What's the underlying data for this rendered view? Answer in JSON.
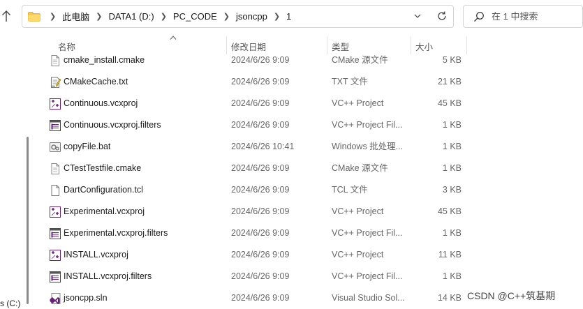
{
  "address": {
    "crumbs": [
      "此电脑",
      "DATA1 (D:)",
      "PC_CODE",
      "jsoncpp",
      "1"
    ]
  },
  "search": {
    "placeholder": "在 1 中搜索"
  },
  "left_pane": {
    "drive_label": "s (C:)"
  },
  "columns": {
    "name": "名称",
    "date": "修改日期",
    "type": "类型",
    "size": "大小"
  },
  "files": [
    {
      "name": "cmake_install.cmake",
      "date": "2024/6/26 9:09",
      "type": "CMake 源文件",
      "size": "5 KB",
      "icon": "cmake-file-icon"
    },
    {
      "name": "CMakeCache.txt",
      "date": "2024/6/26 9:09",
      "type": "TXT 文件",
      "size": "21 KB",
      "icon": "text-file-icon"
    },
    {
      "name": "Continuous.vcxproj",
      "date": "2024/6/26 9:09",
      "type": "VC++ Project",
      "size": "45 KB",
      "icon": "vcxproj-icon"
    },
    {
      "name": "Continuous.vcxproj.filters",
      "date": "2024/6/26 9:09",
      "type": "VC++ Project Fil...",
      "size": "1 KB",
      "icon": "filters-icon"
    },
    {
      "name": "copyFile.bat",
      "date": "2024/6/26 10:41",
      "type": "Windows 批处理...",
      "size": "1 KB",
      "icon": "bat-file-icon"
    },
    {
      "name": "CTestTestfile.cmake",
      "date": "2024/6/26 9:09",
      "type": "CMake 源文件",
      "size": "1 KB",
      "icon": "cmake-file-icon"
    },
    {
      "name": "DartConfiguration.tcl",
      "date": "2024/6/26 9:09",
      "type": "TCL 文件",
      "size": "3 KB",
      "icon": "blank-file-icon"
    },
    {
      "name": "Experimental.vcxproj",
      "date": "2024/6/26 9:09",
      "type": "VC++ Project",
      "size": "45 KB",
      "icon": "vcxproj-icon"
    },
    {
      "name": "Experimental.vcxproj.filters",
      "date": "2024/6/26 9:09",
      "type": "VC++ Project Fil...",
      "size": "1 KB",
      "icon": "filters-icon"
    },
    {
      "name": "INSTALL.vcxproj",
      "date": "2024/6/26 9:09",
      "type": "VC++ Project",
      "size": "11 KB",
      "icon": "vcxproj-icon"
    },
    {
      "name": "INSTALL.vcxproj.filters",
      "date": "2024/6/26 9:09",
      "type": "VC++ Project Fil...",
      "size": "1 KB",
      "icon": "filters-icon"
    },
    {
      "name": "jsoncpp.sln",
      "date": "2024/6/26 9:09",
      "type": "Visual Studio Sol...",
      "size": "14 KB",
      "icon": "sln-file-icon"
    }
  ],
  "watermark": "CSDN @C++筑基期",
  "colors": {
    "folder": "#f5c451",
    "vs_purple": "#68217a",
    "text_gray": "#666666"
  }
}
